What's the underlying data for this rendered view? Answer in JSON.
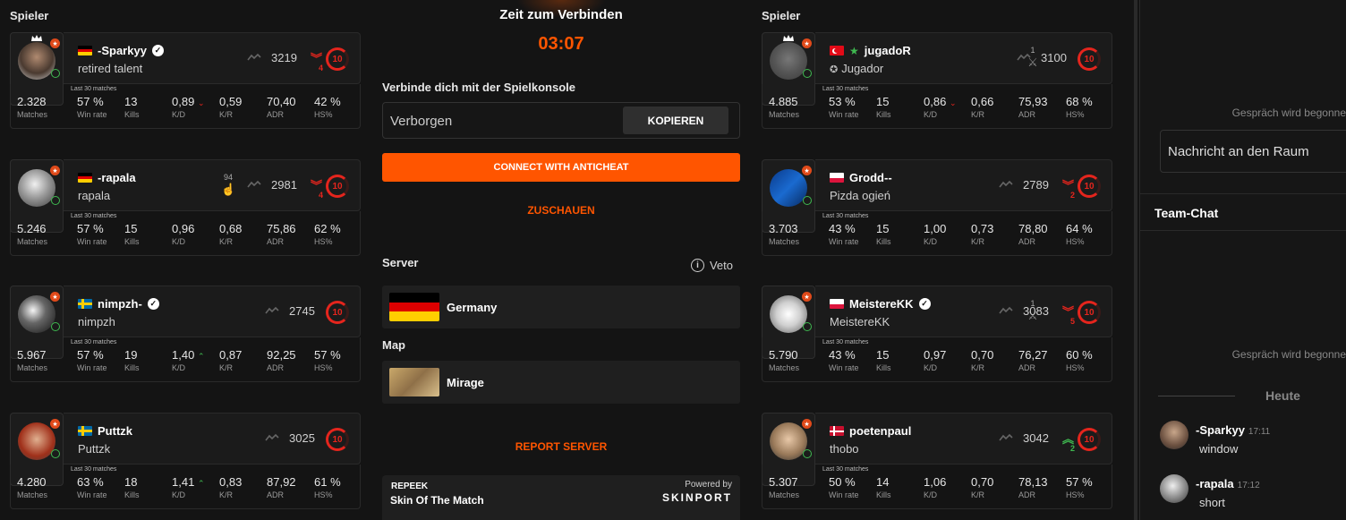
{
  "left_header": "Spieler",
  "right_header": "Spieler",
  "stat_caption": "Last 30 matches",
  "stat_labels": {
    "matches": "Matches",
    "winrate": "Win rate",
    "kills": "Kills",
    "kd": "K/D",
    "kr": "K/R",
    "adr": "ADR",
    "hs": "HS%"
  },
  "left_players": [
    {
      "name": "-Sparkyy",
      "sub": "retired talent",
      "flag": "de",
      "verified": true,
      "elo": "3219",
      "level": "10",
      "streak": "4",
      "streak_dir": "down",
      "crown": true,
      "stats": {
        "matches": "2.328",
        "winrate": "57 %",
        "kills": "13",
        "kd": "0,89",
        "kd_arrow": "down",
        "kr": "0,59",
        "adr": "70,40",
        "hs": "42 %"
      }
    },
    {
      "name": "-rapala",
      "sub": "rapala",
      "flag": "de",
      "verified": false,
      "elo": "2981",
      "level": "10",
      "streak": "4",
      "streak_dir": "down",
      "extra": "94",
      "extra_icon": "handshake-icon",
      "stats": {
        "matches": "5.246",
        "winrate": "57 %",
        "kills": "15",
        "kd": "0,96",
        "kr": "0,68",
        "adr": "75,86",
        "hs": "62 %"
      }
    },
    {
      "name": "nimpzh-",
      "sub": "nimpzh",
      "flag": "se",
      "verified": true,
      "elo": "2745",
      "level": "10",
      "stats": {
        "matches": "5.967",
        "winrate": "57 %",
        "kills": "19",
        "kd": "1,40",
        "kd_arrow": "up",
        "kr": "0,87",
        "adr": "92,25",
        "hs": "57 %"
      }
    },
    {
      "name": "Puttzk",
      "sub": "Puttzk",
      "flag": "se",
      "verified": false,
      "elo": "3025",
      "level": "10",
      "stats": {
        "matches": "4.280",
        "winrate": "63 %",
        "kills": "18",
        "kd": "1,41",
        "kd_arrow": "up",
        "kr": "0,83",
        "adr": "87,92",
        "hs": "61 %"
      }
    }
  ],
  "right_players": [
    {
      "name": "jugadoR",
      "sub": "Jugador",
      "flag": "tr",
      "verified": false,
      "elo": "3100",
      "level": "10",
      "extra": "1",
      "extra_icon": "swords-icon",
      "crown": true,
      "stats": {
        "matches": "4.885",
        "winrate": "53 %",
        "kills": "15",
        "kd": "0,86",
        "kd_arrow": "down",
        "kr": "0,66",
        "adr": "75,93",
        "hs": "68 %"
      }
    },
    {
      "name": "Grodd--",
      "sub": "Pizda ogień",
      "flag": "pl",
      "verified": false,
      "elo": "2789",
      "level": "10",
      "streak": "2",
      "streak_dir": "down",
      "stats": {
        "matches": "3.703",
        "winrate": "43 %",
        "kills": "15",
        "kd": "1,00",
        "kr": "0,73",
        "adr": "78,80",
        "hs": "64 %"
      }
    },
    {
      "name": "MeistereKK",
      "sub": "MeistereKK",
      "flag": "pl",
      "verified": true,
      "elo": "3083",
      "level": "10",
      "streak": "5",
      "streak_dir": "down",
      "extra": "1",
      "extra_icon": "swords-icon",
      "stats": {
        "matches": "5.790",
        "winrate": "43 %",
        "kills": "15",
        "kd": "0,97",
        "kr": "0,70",
        "adr": "76,27",
        "hs": "60 %"
      }
    },
    {
      "name": "poetenpaul",
      "sub": "thobo",
      "flag": "dk",
      "verified": false,
      "elo": "3042",
      "level": "10",
      "streak": "2",
      "streak_dir": "up",
      "stats": {
        "matches": "5.307",
        "winrate": "50 %",
        "kills": "14",
        "kd": "1,06",
        "kr": "0,70",
        "adr": "78,13",
        "hs": "57 %"
      }
    }
  ],
  "center": {
    "title": "Zeit zum Verbinden",
    "timer": "03:07",
    "connect_label": "Verbinde dich mit der Spielkonsole",
    "password_value": "Verborgen",
    "copy_label": "KOPIEREN",
    "anticheat_label": "CONNECT WITH ANTICHEAT",
    "watch_label": "ZUSCHAUEN",
    "server_label": "Server",
    "veto_label": "Veto",
    "server_value": "Germany",
    "map_label": "Map",
    "map_value": "Mirage",
    "report_label": "REPORT SERVER",
    "skin_brand": "REPEEK",
    "skin_title": "Skin Of The Match",
    "powered_by": "Powered by",
    "skinport": "SKINPORT"
  },
  "chat": {
    "started_text": "Gespräch wird begonne",
    "input_placeholder": "Nachricht an den Raum",
    "team_chat": "Team-Chat",
    "day_divider": "Heute",
    "messages": [
      {
        "author": "-Sparkyy",
        "time": "17:11",
        "text": "window"
      },
      {
        "author": "-rapala",
        "time": "17:12",
        "text": "short"
      }
    ]
  },
  "colors": {
    "accent": "#ff5500",
    "level_red": "#e5251d",
    "shield_green": "#3fb950",
    "bg": "#141414"
  }
}
